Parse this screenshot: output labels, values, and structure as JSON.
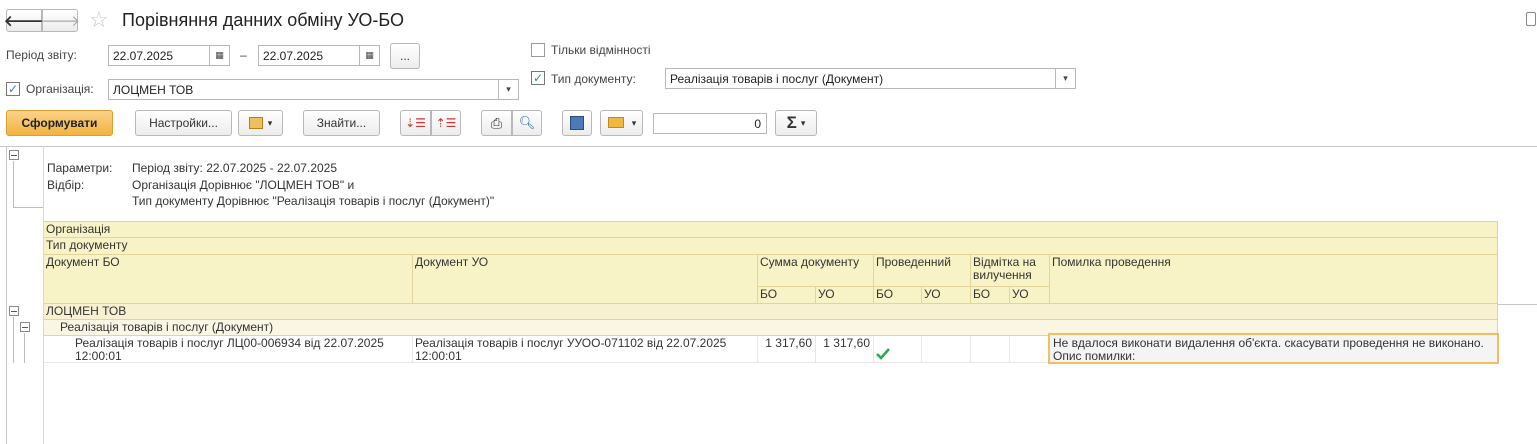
{
  "window": {
    "title": "Порівняння данних обміну УО-БО"
  },
  "form": {
    "period_label": "Період звіту:",
    "date_from": "22.07.2025",
    "date_separator": "–",
    "date_to": "22.07.2025",
    "ellipsis_label": "...",
    "only_diff_label": "Тільки відмінності",
    "only_diff_checked": false,
    "org_label": "Організація:",
    "org_checked": true,
    "org_value": "ЛОЦМЕН ТОВ",
    "doctype_label": "Тип документу:",
    "doctype_checked": true,
    "doctype_value": "Реалізація товарів і послуг (Документ)"
  },
  "toolbar": {
    "generate_label": "Сформувати",
    "settings_label": "Настройки...",
    "find_label": "Знайти...",
    "counter_value": "0",
    "sum_symbol": "Σ"
  },
  "report": {
    "params_label": "Параметри:",
    "params_value": "Період звіту: 22.07.2025 - 22.07.2025",
    "filter_label": "Відбір:",
    "filter_line1": "Організація Дорівнює \"ЛОЦМЕН ТОВ\" и",
    "filter_line2": "Тип документу Дорівнює \"Реалізація товарів і послуг (Документ)\"",
    "headers": {
      "organization": "Організація",
      "doc_type": "Тип документу",
      "doc_bo": "Документ БО",
      "doc_uo": "Документ УО",
      "sum": "Сумма документу",
      "posted": "Проведенний",
      "deletion_mark": "Відмітка на вилучення",
      "posting_error": "Помилка проведення",
      "bo": "БО",
      "uo": "УО"
    },
    "group_org": "ЛОЦМЕН ТОВ",
    "group_doctype": "Реалізація товарів і послуг (Документ)",
    "rows": [
      {
        "doc_bo": "Реалізація товарів і послуг ЛЦ00-006934 від 22.07.2025 12:00:01",
        "doc_uo": "Реалізація товарів і послуг УУОО-071102 від 22.07.2025 12:00:01",
        "sum_bo": "1 317,60",
        "sum_uo": "1 317,60",
        "posted_bo": true,
        "error": "Не вдалося виконати видалення об'єкта. скасувати проведення не виконано. Опис помилки:"
      }
    ]
  }
}
